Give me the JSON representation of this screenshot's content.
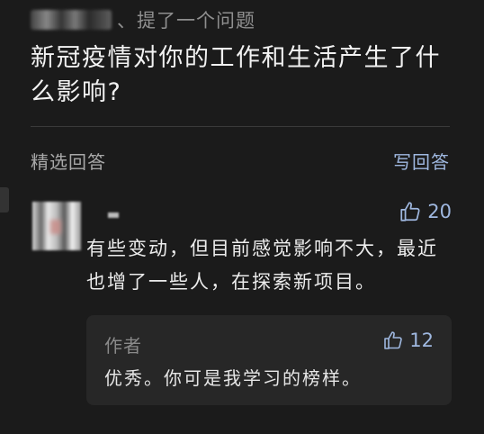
{
  "question": {
    "asker_suffix": "、提了一个问题",
    "title": "新冠疫情对你的工作和生活产生了什么影响?"
  },
  "answers_section": {
    "label": "精选回答",
    "write_answer": "写回答"
  },
  "answer": {
    "likes": "20",
    "text": "有些变动，但目前感觉影响不大，最近也增了一些人，在探索新项目。"
  },
  "reply": {
    "author": "作者",
    "likes": "12",
    "text": "优秀。你可是我学习的榜样。"
  },
  "icons": {
    "like": "thumbs-up-icon"
  },
  "colors": {
    "background": "#1b1b1b",
    "accent": "#9fb8e0",
    "reply_bg": "#272727"
  }
}
